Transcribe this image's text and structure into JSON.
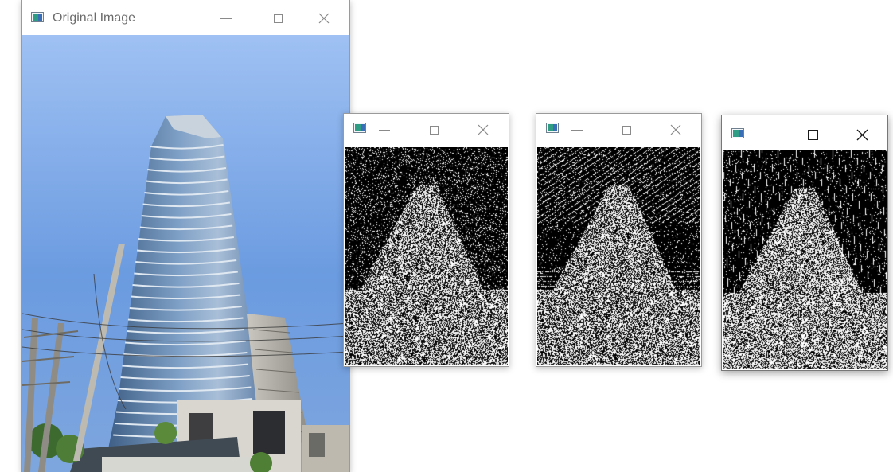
{
  "windows": [
    {
      "id": "original",
      "title": "Original Image",
      "focused": false
    },
    {
      "id": "edges-1",
      "title": "",
      "focused": false
    },
    {
      "id": "edges-2",
      "title": "",
      "focused": false
    },
    {
      "id": "edges-3",
      "title": "",
      "focused": true
    }
  ],
  "icons": {
    "app": "opencv-window-icon",
    "minimize": "minimize-icon",
    "maximize": "maximize-icon",
    "close": "close-icon"
  },
  "colors": {
    "sky_top": "#a9c7f2",
    "sky_bottom": "#5f94de",
    "glass": "#6f8fb2",
    "edge_bg": "#000000",
    "edge_fg": "#ffffff"
  }
}
